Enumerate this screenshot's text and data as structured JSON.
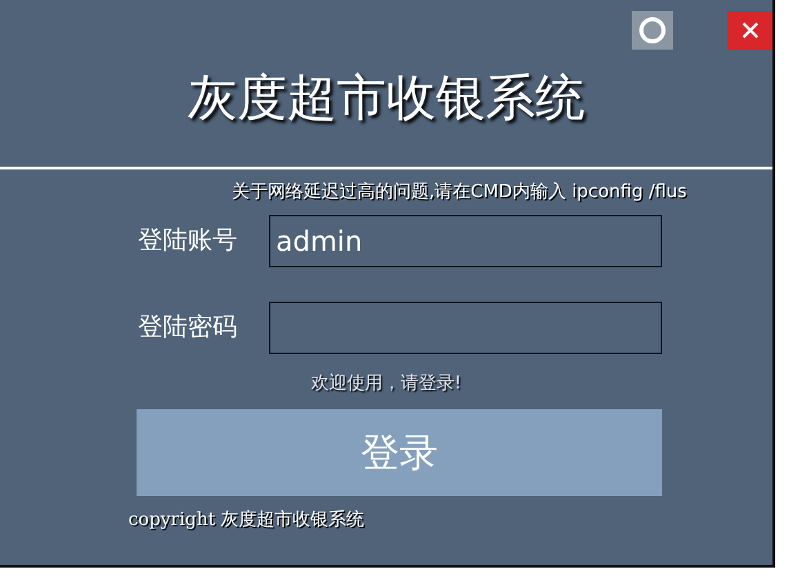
{
  "title": "灰度超市收银系统",
  "notice": "关于网络延迟过高的问题,请在CMD内输入 ipconfig /flus",
  "fields": [
    {
      "label": "登陆账号",
      "value": "admin",
      "kind": "text"
    },
    {
      "label": "登陆密码",
      "kind": "password"
    }
  ],
  "message": "欢迎使用，请登录!",
  "login_button": "登录",
  "copyright": "copyright 灰度超市收银系统"
}
